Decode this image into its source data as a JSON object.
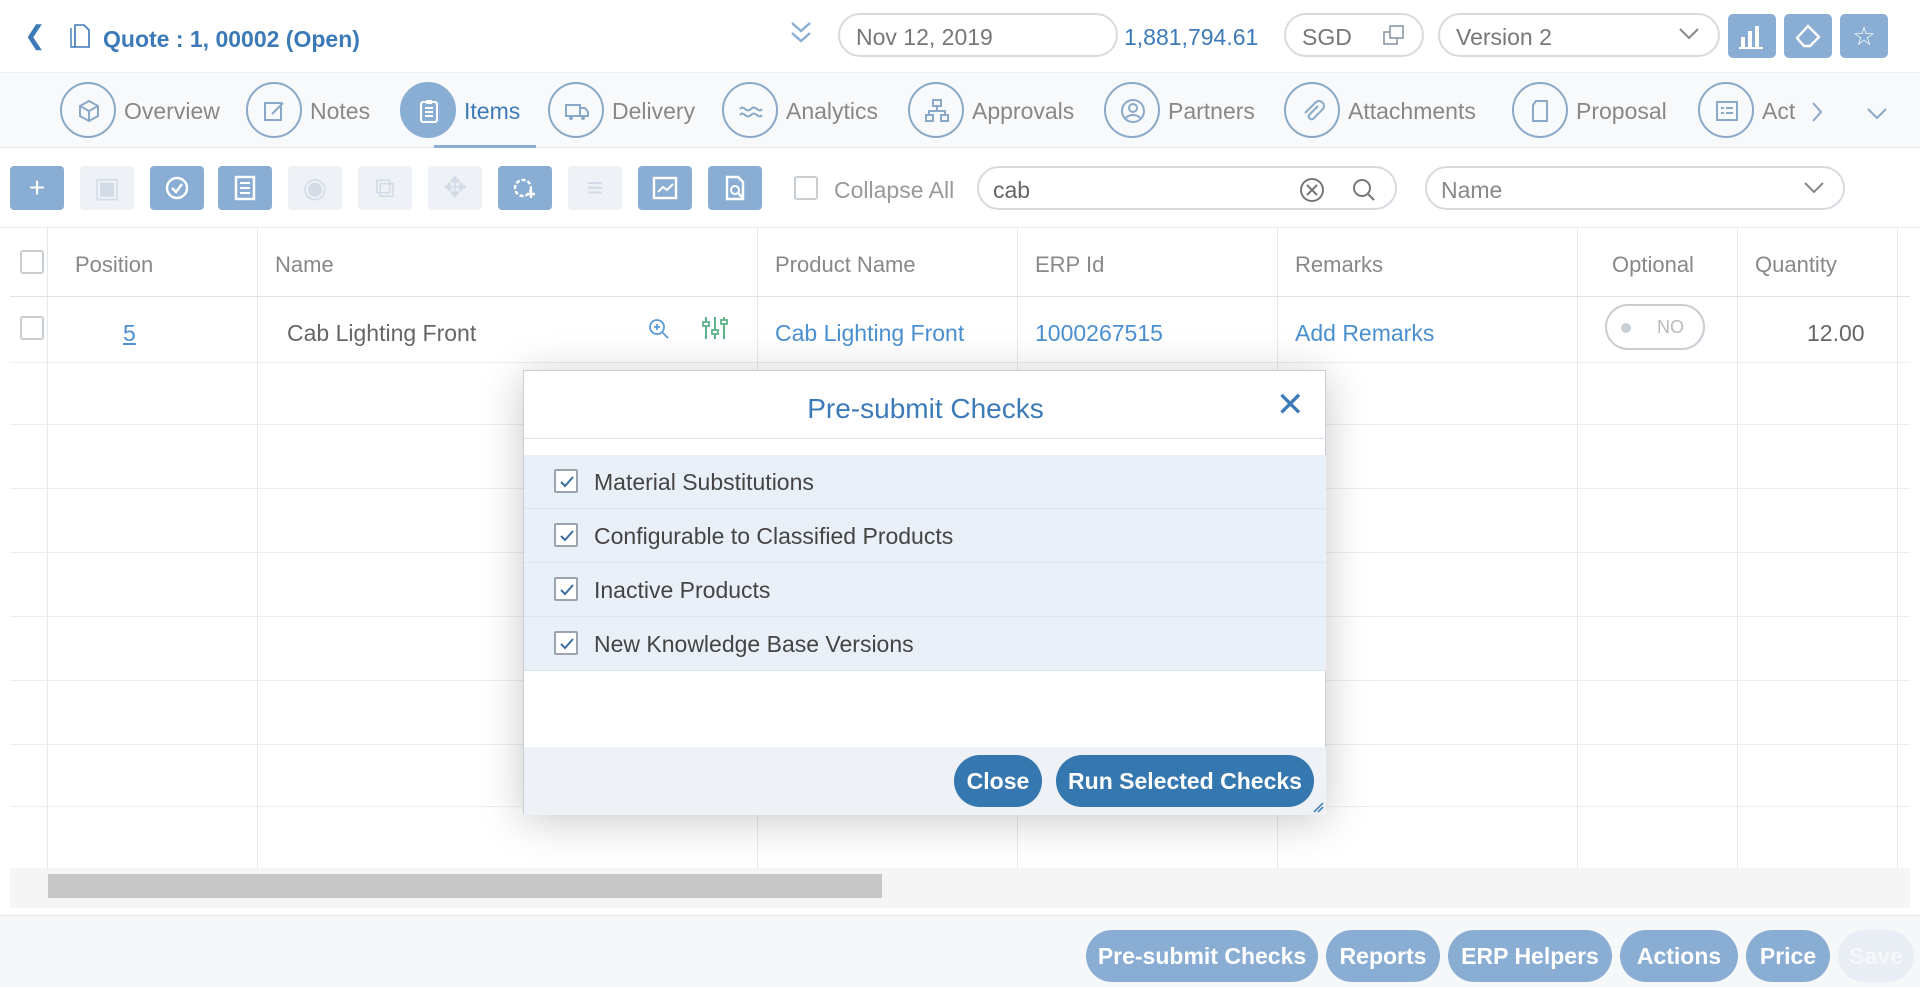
{
  "header": {
    "title": "Quote : 1, 00002 (Open)",
    "date": "Nov 12, 2019",
    "total": "1,881,794.61",
    "currency": "SGD",
    "version": "Version 2"
  },
  "tabs": [
    {
      "label": "Overview",
      "icon": "cube-icon"
    },
    {
      "label": "Notes",
      "icon": "edit-icon"
    },
    {
      "label": "Items",
      "icon": "clipboard-icon",
      "active": true
    },
    {
      "label": "Delivery",
      "icon": "truck-icon"
    },
    {
      "label": "Analytics",
      "icon": "wave-icon"
    },
    {
      "label": "Approvals",
      "icon": "hierarchy-icon"
    },
    {
      "label": "Partners",
      "icon": "user-icon"
    },
    {
      "label": "Attachments",
      "icon": "paperclip-icon"
    },
    {
      "label": "Proposal",
      "icon": "document-icon"
    },
    {
      "label": "Act",
      "icon": "list-icon"
    }
  ],
  "toolbar": {
    "collapse_label": "Collapse All",
    "search_value": "cab",
    "sort_field": "Name"
  },
  "grid": {
    "columns": [
      "Position",
      "Name",
      "Product Name",
      "ERP Id",
      "Remarks",
      "Optional",
      "Quantity"
    ],
    "rows": [
      {
        "position": "5",
        "name": "Cab Lighting Front",
        "product_name": "Cab Lighting Front",
        "erp_id": "1000267515",
        "remarks": "Add Remarks",
        "optional": "NO",
        "quantity": "12.00"
      }
    ]
  },
  "modal": {
    "title": "Pre-submit Checks",
    "checks": [
      {
        "label": "Material Substitutions",
        "checked": true
      },
      {
        "label": "Configurable to Classified Products",
        "checked": true
      },
      {
        "label": "Inactive Products",
        "checked": true
      },
      {
        "label": "New Knowledge Base Versions",
        "checked": true
      }
    ],
    "close_label": "Close",
    "run_label": "Run Selected Checks"
  },
  "footer": {
    "buttons": [
      "Pre-submit Checks",
      "Reports",
      "ERP Helpers",
      "Actions",
      "Price",
      "Save"
    ]
  },
  "colors": {
    "accent": "#3d7ab8",
    "button": "#8aaed3",
    "primary": "#3577af"
  }
}
